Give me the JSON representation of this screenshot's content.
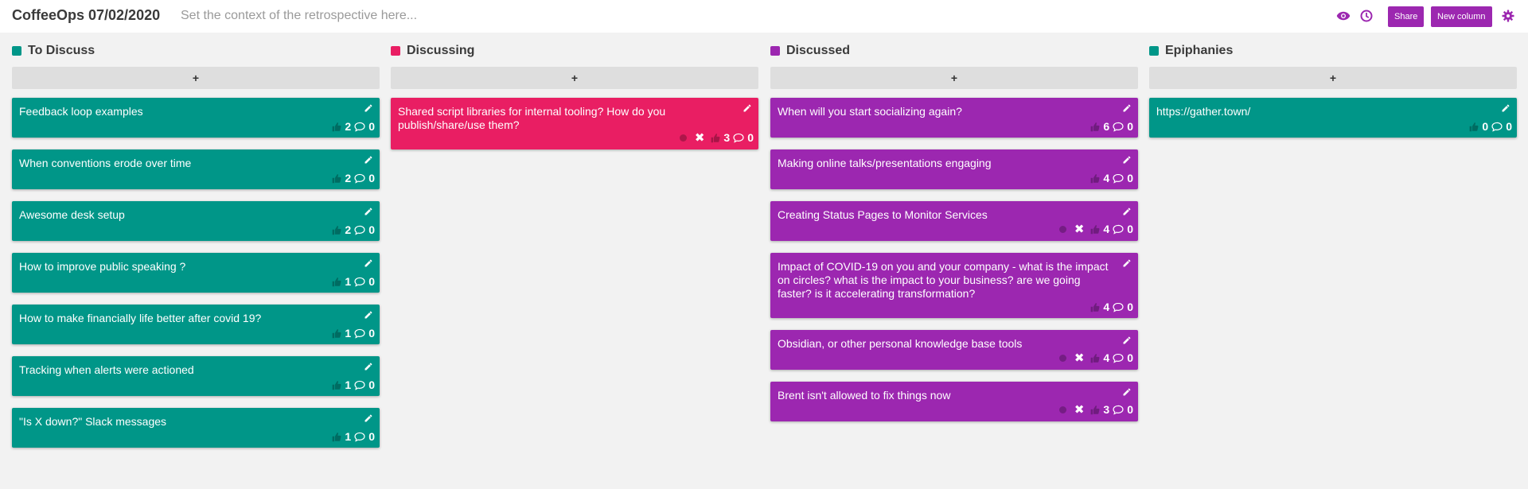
{
  "header": {
    "title": "CoffeeOps 07/02/2020",
    "context_placeholder": "Set the context of the retrospective here...",
    "share_label": "Share",
    "new_column_label": "New column",
    "icons": [
      "eye-icon",
      "clock-icon",
      "gear-icon"
    ]
  },
  "colors": {
    "teal": "#009688",
    "pink": "#e91e63",
    "purple": "#9c27b0",
    "accent": "#9c27b0"
  },
  "add_label": "+",
  "columns": [
    {
      "title": "To Discuss",
      "color": "#009688",
      "cards": [
        {
          "text": "Feedback loop examples",
          "votes": "2",
          "comments": "0",
          "lines": 1
        },
        {
          "text": "When conventions erode over time",
          "votes": "2",
          "comments": "0",
          "lines": 1
        },
        {
          "text": "Awesome desk setup",
          "votes": "2",
          "comments": "0",
          "lines": 1
        },
        {
          "text": "How to improve public speaking ?",
          "votes": "1",
          "comments": "0",
          "lines": 1
        },
        {
          "text": "How to make financially life better after covid 19?",
          "votes": "1",
          "comments": "0",
          "lines": 1
        },
        {
          "text": "Tracking when alerts were actioned",
          "votes": "1",
          "comments": "0",
          "lines": 1
        },
        {
          "text": "\"Is X down?\" Slack messages",
          "votes": "1",
          "comments": "0",
          "lines": 1
        }
      ]
    },
    {
      "title": "Discussing",
      "color": "#e91e63",
      "cards": [
        {
          "text": "Shared script libraries for internal tooling? How do you publish/share/use them?",
          "votes": "3",
          "comments": "0",
          "lines": 2,
          "own": true
        }
      ]
    },
    {
      "title": "Discussed",
      "color": "#9c27b0",
      "cards": [
        {
          "text": "When will you start socializing again?",
          "votes": "6",
          "comments": "0",
          "lines": 1
        },
        {
          "text": "Making online talks/presentations engaging",
          "votes": "4",
          "comments": "0",
          "lines": 1
        },
        {
          "text": "Creating Status Pages to Monitor Services",
          "votes": "4",
          "comments": "0",
          "lines": 1,
          "own": true
        },
        {
          "text": "Impact of COVID-19 on you and your company - what is the impact on circles? what is the impact to your business? are we going faster? is it accelerating transformation?",
          "votes": "4",
          "comments": "0",
          "lines": 3
        },
        {
          "text": "Obsidian, or other personal knowledge base tools",
          "votes": "4",
          "comments": "0",
          "lines": 1,
          "own": true
        },
        {
          "text": "Brent isn't allowed to fix things now",
          "votes": "3",
          "comments": "0",
          "lines": 1,
          "own": true
        }
      ]
    },
    {
      "title": "Epiphanies",
      "color": "#009688",
      "cards": [
        {
          "text": "https://gather.town/",
          "votes": "0",
          "comments": "0",
          "lines": 1,
          "link": true
        }
      ]
    }
  ]
}
